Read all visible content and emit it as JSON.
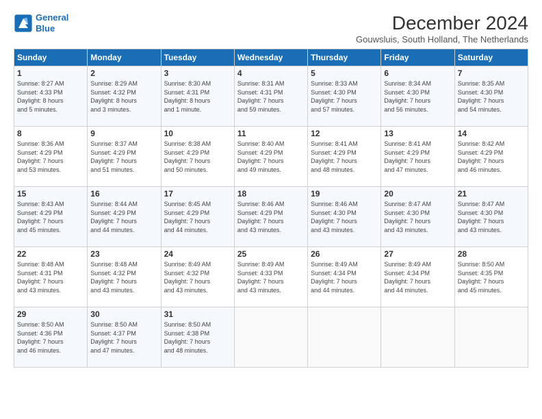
{
  "header": {
    "logo_line1": "General",
    "logo_line2": "Blue",
    "month": "December 2024",
    "location": "Gouwsluis, South Holland, The Netherlands"
  },
  "days_of_week": [
    "Sunday",
    "Monday",
    "Tuesday",
    "Wednesday",
    "Thursday",
    "Friday",
    "Saturday"
  ],
  "weeks": [
    [
      {
        "day": "1",
        "lines": [
          "Sunrise: 8:27 AM",
          "Sunset: 4:33 PM",
          "Daylight: 8 hours",
          "and 5 minutes."
        ]
      },
      {
        "day": "2",
        "lines": [
          "Sunrise: 8:29 AM",
          "Sunset: 4:32 PM",
          "Daylight: 8 hours",
          "and 3 minutes."
        ]
      },
      {
        "day": "3",
        "lines": [
          "Sunrise: 8:30 AM",
          "Sunset: 4:31 PM",
          "Daylight: 8 hours",
          "and 1 minute."
        ]
      },
      {
        "day": "4",
        "lines": [
          "Sunrise: 8:31 AM",
          "Sunset: 4:31 PM",
          "Daylight: 7 hours",
          "and 59 minutes."
        ]
      },
      {
        "day": "5",
        "lines": [
          "Sunrise: 8:33 AM",
          "Sunset: 4:30 PM",
          "Daylight: 7 hours",
          "and 57 minutes."
        ]
      },
      {
        "day": "6",
        "lines": [
          "Sunrise: 8:34 AM",
          "Sunset: 4:30 PM",
          "Daylight: 7 hours",
          "and 56 minutes."
        ]
      },
      {
        "day": "7",
        "lines": [
          "Sunrise: 8:35 AM",
          "Sunset: 4:30 PM",
          "Daylight: 7 hours",
          "and 54 minutes."
        ]
      }
    ],
    [
      {
        "day": "8",
        "lines": [
          "Sunrise: 8:36 AM",
          "Sunset: 4:29 PM",
          "Daylight: 7 hours",
          "and 53 minutes."
        ]
      },
      {
        "day": "9",
        "lines": [
          "Sunrise: 8:37 AM",
          "Sunset: 4:29 PM",
          "Daylight: 7 hours",
          "and 51 minutes."
        ]
      },
      {
        "day": "10",
        "lines": [
          "Sunrise: 8:38 AM",
          "Sunset: 4:29 PM",
          "Daylight: 7 hours",
          "and 50 minutes."
        ]
      },
      {
        "day": "11",
        "lines": [
          "Sunrise: 8:40 AM",
          "Sunset: 4:29 PM",
          "Daylight: 7 hours",
          "and 49 minutes."
        ]
      },
      {
        "day": "12",
        "lines": [
          "Sunrise: 8:41 AM",
          "Sunset: 4:29 PM",
          "Daylight: 7 hours",
          "and 48 minutes."
        ]
      },
      {
        "day": "13",
        "lines": [
          "Sunrise: 8:41 AM",
          "Sunset: 4:29 PM",
          "Daylight: 7 hours",
          "and 47 minutes."
        ]
      },
      {
        "day": "14",
        "lines": [
          "Sunrise: 8:42 AM",
          "Sunset: 4:29 PM",
          "Daylight: 7 hours",
          "and 46 minutes."
        ]
      }
    ],
    [
      {
        "day": "15",
        "lines": [
          "Sunrise: 8:43 AM",
          "Sunset: 4:29 PM",
          "Daylight: 7 hours",
          "and 45 minutes."
        ]
      },
      {
        "day": "16",
        "lines": [
          "Sunrise: 8:44 AM",
          "Sunset: 4:29 PM",
          "Daylight: 7 hours",
          "and 44 minutes."
        ]
      },
      {
        "day": "17",
        "lines": [
          "Sunrise: 8:45 AM",
          "Sunset: 4:29 PM",
          "Daylight: 7 hours",
          "and 44 minutes."
        ]
      },
      {
        "day": "18",
        "lines": [
          "Sunrise: 8:46 AM",
          "Sunset: 4:29 PM",
          "Daylight: 7 hours",
          "and 43 minutes."
        ]
      },
      {
        "day": "19",
        "lines": [
          "Sunrise: 8:46 AM",
          "Sunset: 4:30 PM",
          "Daylight: 7 hours",
          "and 43 minutes."
        ]
      },
      {
        "day": "20",
        "lines": [
          "Sunrise: 8:47 AM",
          "Sunset: 4:30 PM",
          "Daylight: 7 hours",
          "and 43 minutes."
        ]
      },
      {
        "day": "21",
        "lines": [
          "Sunrise: 8:47 AM",
          "Sunset: 4:30 PM",
          "Daylight: 7 hours",
          "and 43 minutes."
        ]
      }
    ],
    [
      {
        "day": "22",
        "lines": [
          "Sunrise: 8:48 AM",
          "Sunset: 4:31 PM",
          "Daylight: 7 hours",
          "and 43 minutes."
        ]
      },
      {
        "day": "23",
        "lines": [
          "Sunrise: 8:48 AM",
          "Sunset: 4:32 PM",
          "Daylight: 7 hours",
          "and 43 minutes."
        ]
      },
      {
        "day": "24",
        "lines": [
          "Sunrise: 8:49 AM",
          "Sunset: 4:32 PM",
          "Daylight: 7 hours",
          "and 43 minutes."
        ]
      },
      {
        "day": "25",
        "lines": [
          "Sunrise: 8:49 AM",
          "Sunset: 4:33 PM",
          "Daylight: 7 hours",
          "and 43 minutes."
        ]
      },
      {
        "day": "26",
        "lines": [
          "Sunrise: 8:49 AM",
          "Sunset: 4:34 PM",
          "Daylight: 7 hours",
          "and 44 minutes."
        ]
      },
      {
        "day": "27",
        "lines": [
          "Sunrise: 8:49 AM",
          "Sunset: 4:34 PM",
          "Daylight: 7 hours",
          "and 44 minutes."
        ]
      },
      {
        "day": "28",
        "lines": [
          "Sunrise: 8:50 AM",
          "Sunset: 4:35 PM",
          "Daylight: 7 hours",
          "and 45 minutes."
        ]
      }
    ],
    [
      {
        "day": "29",
        "lines": [
          "Sunrise: 8:50 AM",
          "Sunset: 4:36 PM",
          "Daylight: 7 hours",
          "and 46 minutes."
        ]
      },
      {
        "day": "30",
        "lines": [
          "Sunrise: 8:50 AM",
          "Sunset: 4:37 PM",
          "Daylight: 7 hours",
          "and 47 minutes."
        ]
      },
      {
        "day": "31",
        "lines": [
          "Sunrise: 8:50 AM",
          "Sunset: 4:38 PM",
          "Daylight: 7 hours",
          "and 48 minutes."
        ]
      },
      null,
      null,
      null,
      null
    ]
  ]
}
